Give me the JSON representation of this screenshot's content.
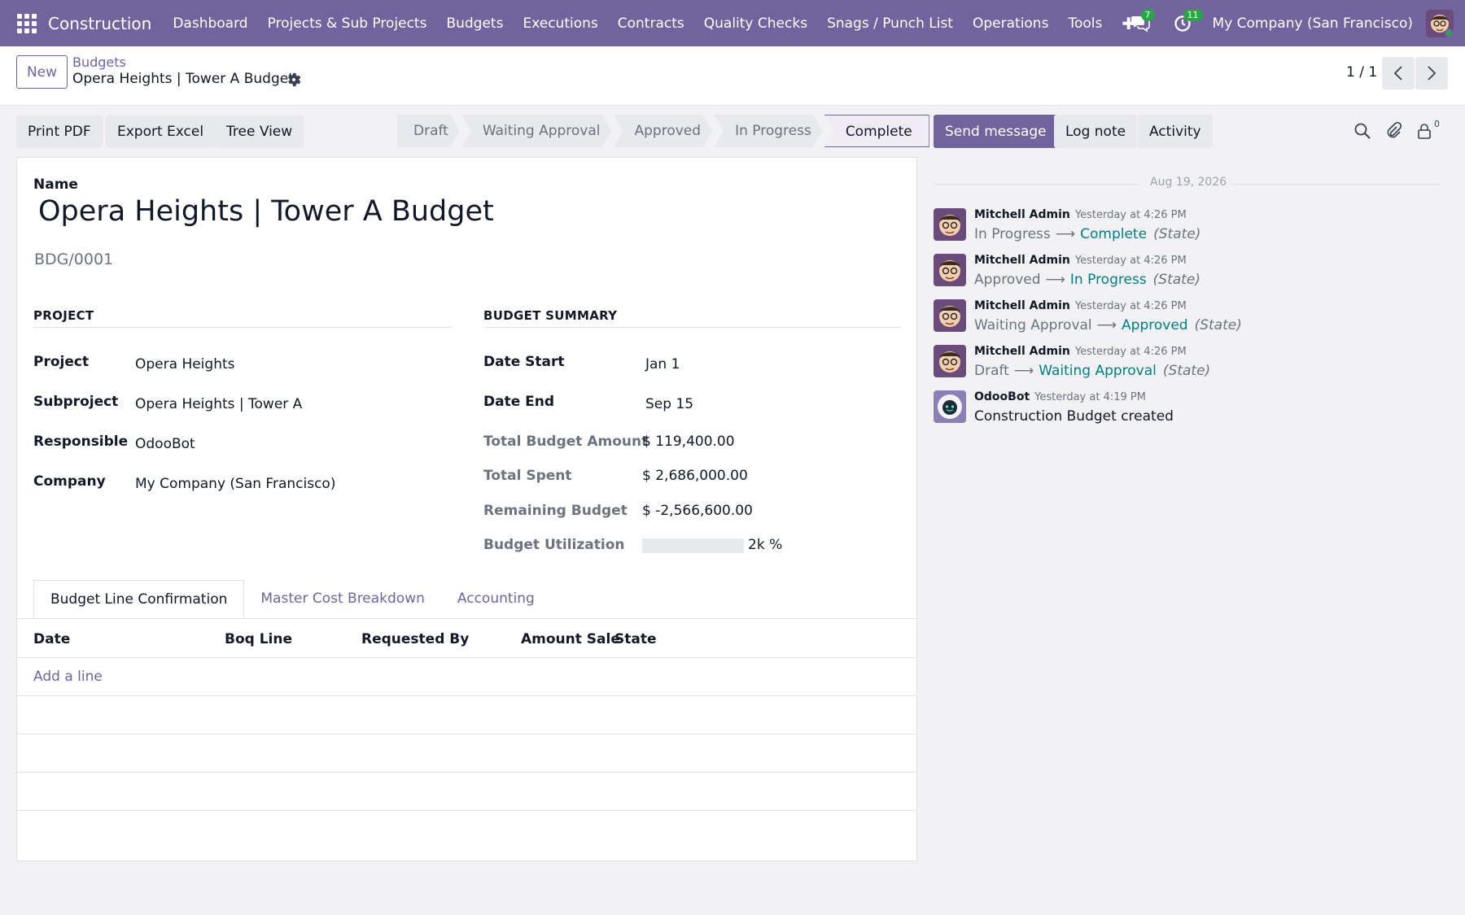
{
  "navbar": {
    "brand": "Construction",
    "menu": [
      "Dashboard",
      "Projects & Sub Projects",
      "Budgets",
      "Executions",
      "Contracts",
      "Quality Checks",
      "Snags / Punch List",
      "Operations",
      "Tools"
    ],
    "messages_count": "7",
    "activities_count": "11",
    "company": "My Company (San Francisco)"
  },
  "control": {
    "new_label": "New",
    "breadcrumb_parent": "Budgets",
    "breadcrumb_current": "Opera Heights | Tower A Budget",
    "pager": "1 / 1"
  },
  "actions": {
    "print_pdf": "Print PDF",
    "export_excel": "Export Excel",
    "tree_view": "Tree View"
  },
  "status": {
    "stages": [
      "Draft",
      "Waiting Approval",
      "Approved",
      "In Progress",
      "Complete"
    ],
    "active": "Complete"
  },
  "form": {
    "name_label": "Name",
    "name": "Opera Heights | Tower A Budget",
    "reference": "BDG/0001",
    "project_section": "PROJECT",
    "summary_section": "BUDGET SUMMARY",
    "project_label": "Project",
    "project": "Opera Heights",
    "subproject_label": "Subproject",
    "subproject": "Opera Heights | Tower A",
    "responsible_label": "Responsible",
    "responsible": "OdooBot",
    "company_label": "Company",
    "company": "My Company (San Francisco)",
    "date_start_label": "Date Start",
    "date_start": "Jan 1",
    "date_end_label": "Date End",
    "date_end": "Sep 15",
    "total_budget_label": "Total Budget Amount",
    "total_budget": "$ 119,400.00",
    "total_spent_label": "Total Spent",
    "total_spent": "$ 2,686,000.00",
    "remaining_label": "Remaining Budget",
    "remaining": "$ -2,566,600.00",
    "utilization_label": "Budget Utilization",
    "utilization": "2k %",
    "utilization_fill_fraction": 0
  },
  "tabs": [
    "Budget Line Confirmation",
    "Master Cost Breakdown",
    "Accounting"
  ],
  "table": {
    "columns": [
      "Date",
      "Boq Line",
      "Requested By",
      "Amount Sale",
      "State"
    ],
    "add_line": "Add a line"
  },
  "chatter": {
    "send_message": "Send message",
    "log_note": "Log note",
    "activity": "Activity",
    "followers_count": "0",
    "date_separator": "Aug 19, 2026",
    "messages": [
      {
        "author": "Mitchell Admin",
        "time": "Yesterday at 4:26 PM",
        "from": "In Progress",
        "to": "Complete",
        "field": "(State)"
      },
      {
        "author": "Mitchell Admin",
        "time": "Yesterday at 4:26 PM",
        "from": "Approved",
        "to": "In Progress",
        "field": "(State)"
      },
      {
        "author": "Mitchell Admin",
        "time": "Yesterday at 4:26 PM",
        "from": "Waiting Approval",
        "to": "Approved",
        "field": "(State)"
      },
      {
        "author": "Mitchell Admin",
        "time": "Yesterday at 4:26 PM",
        "from": "Draft",
        "to": "Waiting Approval",
        "field": "(State)"
      },
      {
        "author": "OdooBot",
        "time": "Yesterday at 4:19 PM",
        "text": "Construction Budget created"
      }
    ]
  },
  "colors": {
    "brand": "#71639e",
    "link_teal": "#017e84",
    "badge_green": "#28a745"
  }
}
